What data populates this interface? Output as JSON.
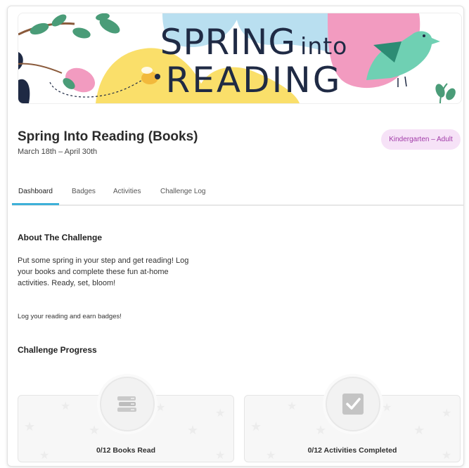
{
  "banner": {
    "title_line1": "SPRING",
    "title_into": "into",
    "title_line2": "READING"
  },
  "challenge": {
    "title": "Spring Into Reading (Books)",
    "dates": "March 18th – April 30th",
    "audience": "Kindergarten – Adult"
  },
  "tabs": [
    {
      "label": "Dashboard",
      "active": true
    },
    {
      "label": "Badges",
      "active": false
    },
    {
      "label": "Activities",
      "active": false
    },
    {
      "label": "Challenge Log",
      "active": false
    }
  ],
  "about": {
    "heading": "About The Challenge",
    "description": "Put some spring in your step and get reading! Log your books and complete these fun at-home activities. Ready, set, bloom!",
    "log_prompt": "Log your reading and earn badges!"
  },
  "progress": {
    "heading": "Challenge Progress",
    "cards": [
      {
        "label": "0/12 Books Read",
        "icon": "books-stack-icon",
        "completed": 0,
        "total": 12
      },
      {
        "label": "0/12 Activities Completed",
        "icon": "checkbox-icon",
        "completed": 0,
        "total": 12
      }
    ]
  },
  "colors": {
    "accent_tab": "#3db0d8",
    "badge_bg": "#f6e2f7",
    "badge_text": "#a13ba8",
    "banner_pink": "#f29bc0",
    "banner_blue": "#b9dff0",
    "banner_yellow": "#fadf6a",
    "banner_bird": "#6fd0b3",
    "banner_leaf": "#4a9c78"
  }
}
